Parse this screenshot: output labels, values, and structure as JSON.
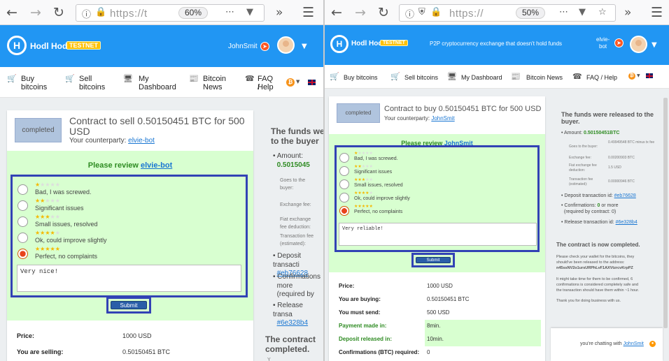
{
  "left": {
    "url_hint": "https://t",
    "zoom": "60%",
    "brand": "Hodl Hodl",
    "testnet": "TESTNET",
    "username": "JohnSmit",
    "nav": [
      {
        "icon": "cart-icon",
        "l1": "Buy",
        "l2": "bitcoins"
      },
      {
        "icon": "cart-icon",
        "l1": "Sell",
        "l2": "bitcoins"
      },
      {
        "icon": "monitor-icon",
        "l1": "My",
        "l2": "Dashboard"
      },
      {
        "icon": "news-icon",
        "l1": "Bitcoin",
        "l2": "News"
      },
      {
        "icon": "support-icon",
        "l1": "FAQ /",
        "l2": "Help"
      }
    ],
    "status": "completed",
    "title_l1": "Contract to sell 0.50150451 BTC for 500",
    "title_l2": "USD",
    "counterparty_label": "Your counterparty:",
    "counterparty": "elvie-bot",
    "review_prefix": "Please review",
    "review_user": "elvie-bot",
    "options": [
      "Bad, I was screwed.",
      "Significant issues",
      "Small issues, resolved",
      "Ok, could improve slightly",
      "Perfect, no complaints"
    ],
    "selected_option": 5,
    "comment": "Very nice!",
    "submit": "Submit",
    "rows": [
      {
        "k": "Price:",
        "v": "1000 USD"
      },
      {
        "k": "You are selling:",
        "v": "0.50150451 BTC"
      }
    ],
    "side": {
      "title_l1": "The funds we",
      "title_l2": "to the buyer",
      "amount_label": "Amount:",
      "amount": "0.5015045",
      "goes_l1": "Goes to the",
      "goes_l2": "buyer:",
      "exch": "Exchange fee:",
      "fiat_l1": "Fiat exchange",
      "fiat_l2": "fee deduction:",
      "tx_l1": "Transaction fee",
      "tx_l2": "(estimated):",
      "deposit_l1": "Deposit transacti",
      "deposit_link": "#eb76628",
      "conf_l1": "Confirmations",
      "conf_l2": "more",
      "conf_l3": "(required by",
      "release_l1": "Release transa",
      "release_link": "#6e328b4",
      "completed_l1": "The contract",
      "completed_l2": "completed.",
      "tail": "Y"
    }
  },
  "right": {
    "url_hint": "https://",
    "zoom": "50%",
    "brand": "Hodl Hodl",
    "testnet": "TESTNET",
    "tagline": "P2P cryptocurrency exchange that doesn't hold funds",
    "username_l1": "elvie-",
    "username_l2": "bot",
    "nav": [
      {
        "icon": "cart-icon",
        "label": "Buy bitcoins"
      },
      {
        "icon": "cart-icon",
        "label": "Sell bitcoins"
      },
      {
        "icon": "monitor-icon",
        "label": "My Dashboard"
      },
      {
        "icon": "news-icon",
        "label": "Bitcoin News"
      },
      {
        "icon": "support-icon",
        "label": "FAQ / Help"
      }
    ],
    "status": "completed",
    "title": "Contract to buy 0.50150451 BTC for 500 USD",
    "counterparty_label": "Your counterparty:",
    "counterparty": "JohnSmit",
    "review_prefix": "Please review",
    "review_user": "JohnSmit",
    "options": [
      "Bad, I was screwed.",
      "Significant issues",
      "Small issues, resolved",
      "Ok, could improve slightly",
      "Perfect, no complaints"
    ],
    "selected_option": 5,
    "comment": "Very reliable!",
    "submit": "Submit",
    "rows": [
      {
        "k": "Price:",
        "v": "1000 USD",
        "green": false
      },
      {
        "k": "You are buying:",
        "v": "0.50150451 BTC",
        "green": false
      },
      {
        "k": "You must send:",
        "v": "500 USD",
        "green": false
      },
      {
        "k": "Payment made in:",
        "v": "8min.",
        "green": true
      },
      {
        "k": "Deposit released in:",
        "v": "10min.",
        "green": true
      },
      {
        "k": "Confirmations (BTC) required:",
        "v": "0",
        "green": false
      }
    ],
    "side": {
      "title_l1": "The funds were released to the",
      "title_l2": "buyer.",
      "amount_label": "Amount:",
      "amount": "0.50150451BTC",
      "fees": [
        {
          "k": "Goes to the buyer:",
          "v": "0.49949548 BTC minus tx fee"
        },
        {
          "k": "Exchange fee:",
          "v": "0.00200903 BTC"
        },
        {
          "k": "Fiat exchange fee deduction:",
          "v": "1.5 USD"
        },
        {
          "k": "Transaction fee (estimated):",
          "v": "0.00000946 BTC"
        }
      ],
      "deposit_label": "Deposit transaction id:",
      "deposit_link": "#eb76628",
      "conf_label": "Confirmations:",
      "conf_val": "0",
      "conf_rest": "or more",
      "conf_l2": "(required by contract: 0)",
      "release_label": "Release transaction id:",
      "release_link": "#6e328b4",
      "completed": "The contract is now completed.",
      "p1_l1": "Please check your wallet for the bitcoins, they",
      "p1_l2": "should've been released to the address:",
      "p1_l3": "n45ssNV2o1ursURPhLvF1AXVtzrcvKrpPZ",
      "p2_l1": "It might take time for them to be confirmed, 6",
      "p2_l2": "confirmations is considered completely safe and",
      "p2_l3": "the transaction should have them within ~1 hour.",
      "p3": "Thank you for doing business with us."
    },
    "chat_prefix": "you're chatting with",
    "chat_user": "JohnSmit"
  }
}
